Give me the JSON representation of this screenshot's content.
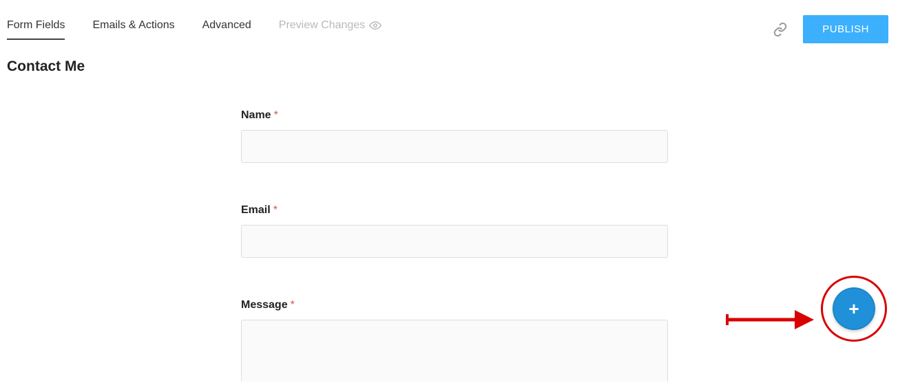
{
  "tabs": {
    "form_fields": "Form Fields",
    "emails_actions": "Emails & Actions",
    "advanced": "Advanced",
    "preview_changes": "Preview Changes"
  },
  "actions": {
    "publish": "PUBLISH"
  },
  "page_title": "Contact Me",
  "fields": {
    "name": {
      "label": "Name",
      "required": "*"
    },
    "email": {
      "label": "Email",
      "required": "*"
    },
    "message": {
      "label": "Message",
      "required": "*"
    }
  },
  "fab": {
    "plus": "+"
  }
}
